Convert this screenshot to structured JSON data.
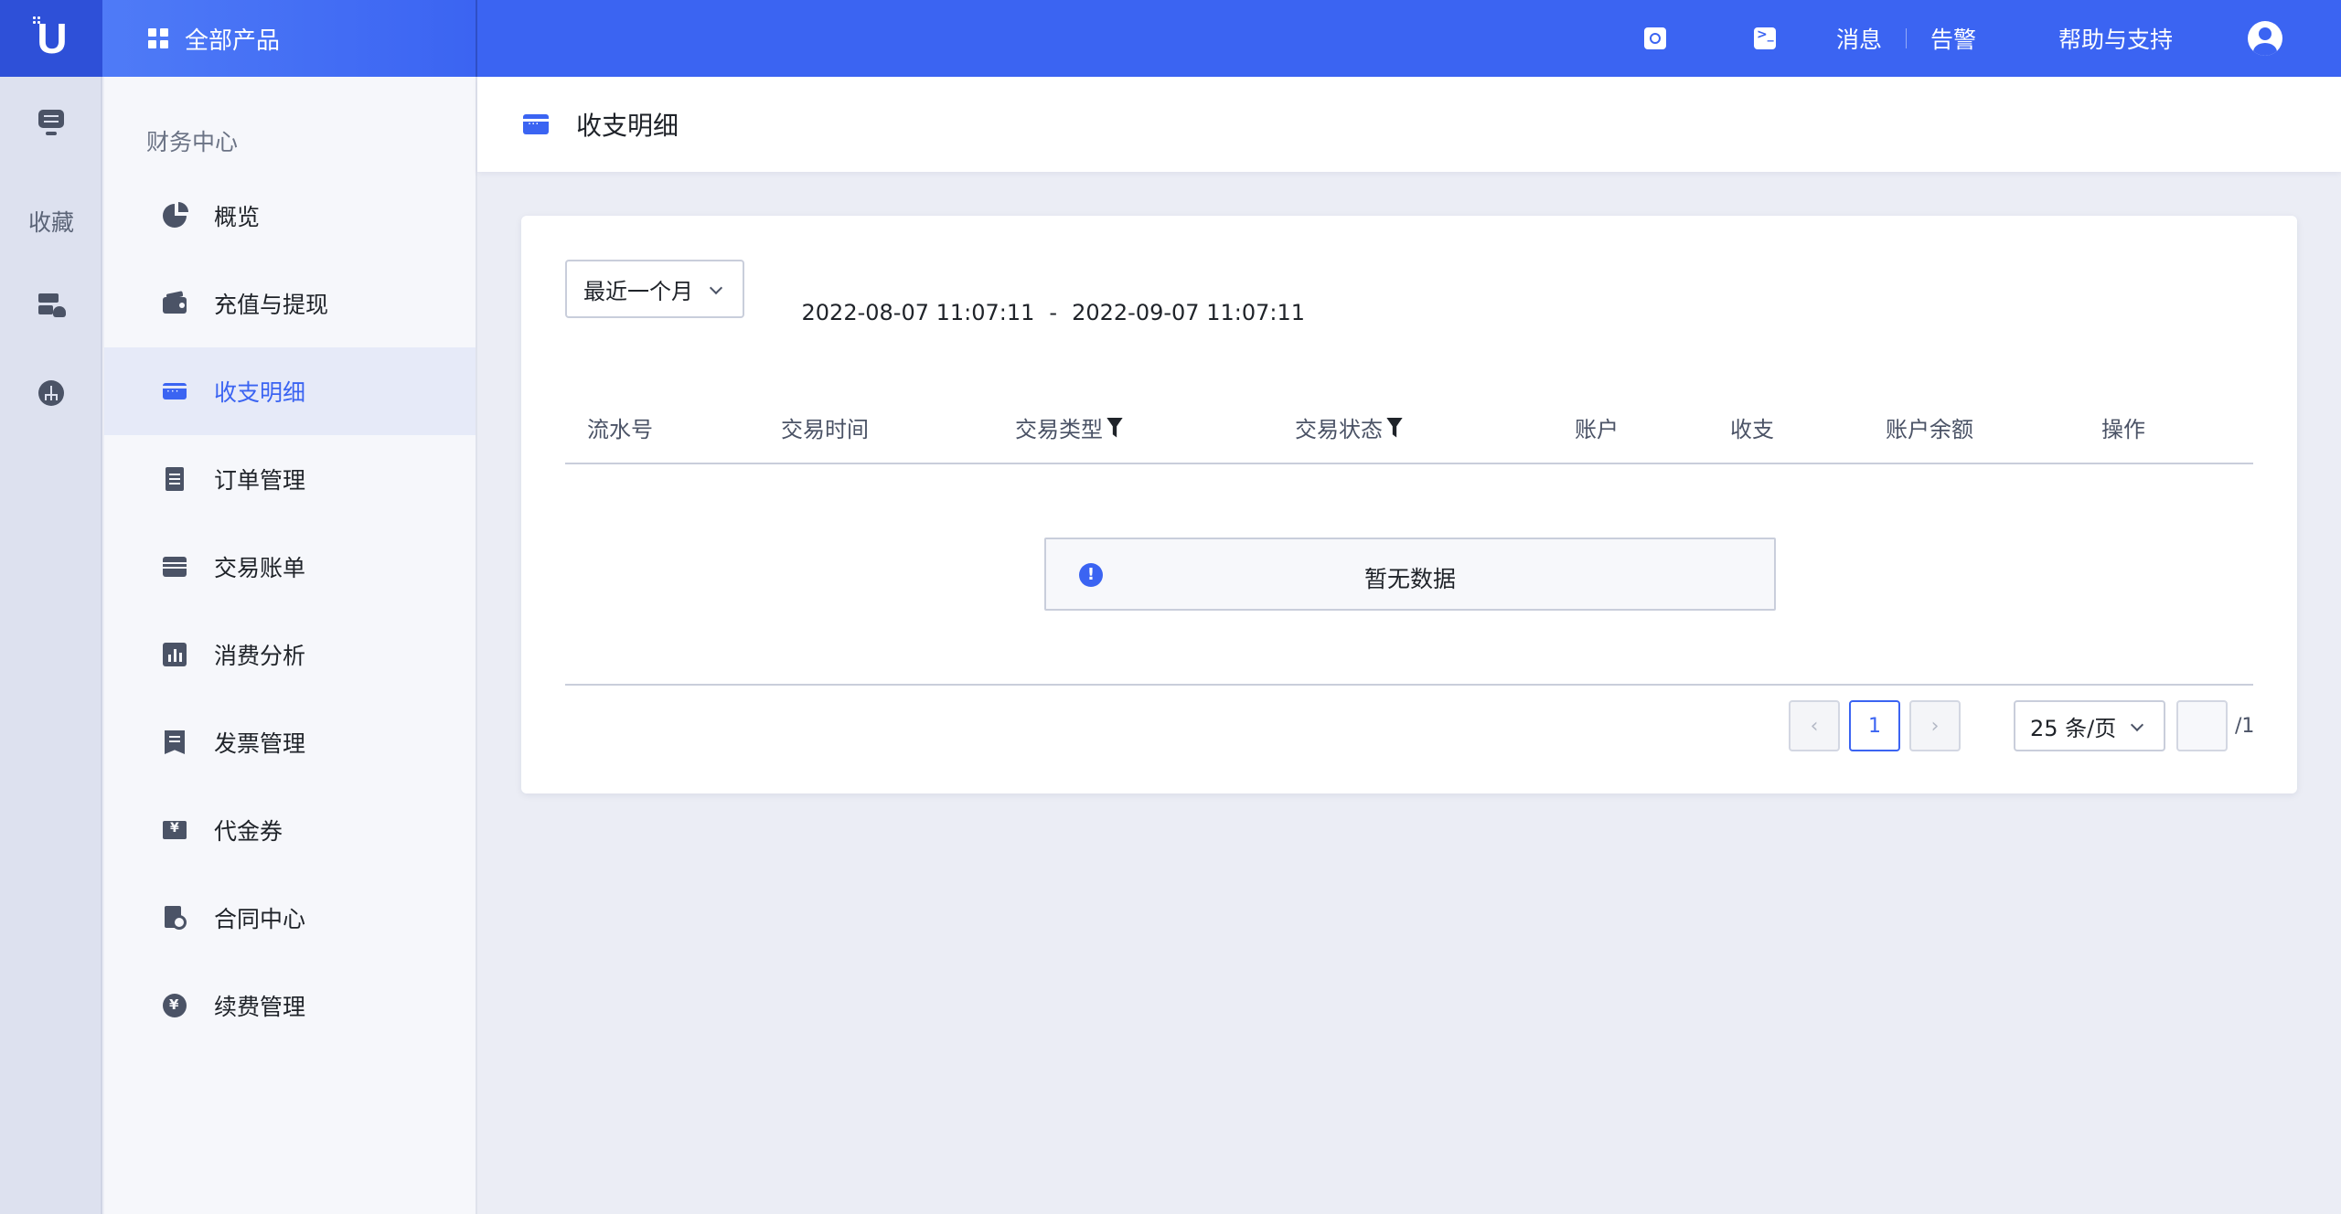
{
  "topbar": {
    "logo_letter": "U",
    "all_products": "全部产品",
    "messages": "消息",
    "alerts": "告警",
    "help": "帮助与支持",
    "icons": [
      "search-icon",
      "terminal-icon",
      "user-icon"
    ]
  },
  "rail": {
    "favorites": "收藏",
    "icons": [
      "monitor-icon",
      "server-icon",
      "network-icon"
    ]
  },
  "sidebar": {
    "section_title": "财务中心",
    "items": [
      {
        "label": "概览",
        "icon": "pie-chart-icon"
      },
      {
        "label": "充值与提现",
        "icon": "wallet-icon"
      },
      {
        "label": "收支明细",
        "icon": "card-icon",
        "active": true
      },
      {
        "label": "订单管理",
        "icon": "document-icon"
      },
      {
        "label": "交易账单",
        "icon": "bill-icon"
      },
      {
        "label": "消费分析",
        "icon": "bar-chart-icon"
      },
      {
        "label": "发票管理",
        "icon": "invoice-icon"
      },
      {
        "label": "代金券",
        "icon": "coupon-icon"
      },
      {
        "label": "合同中心",
        "icon": "contract-icon"
      },
      {
        "label": "续费管理",
        "icon": "renew-icon"
      }
    ]
  },
  "page": {
    "title": "收支明细"
  },
  "filter": {
    "range_selected": "最近一个月",
    "date_start": "2022-08-07 11:07:11",
    "date_separator": "-",
    "date_end": "2022-09-07 11:07:11"
  },
  "table": {
    "columns": [
      {
        "label": "流水号",
        "filterable": false
      },
      {
        "label": "交易时间",
        "filterable": false
      },
      {
        "label": "交易类型",
        "filterable": true
      },
      {
        "label": "交易状态",
        "filterable": true
      },
      {
        "label": "账户",
        "filterable": false
      },
      {
        "label": "收支",
        "filterable": false
      },
      {
        "label": "账户余额",
        "filterable": false
      },
      {
        "label": "操作",
        "filterable": false
      }
    ],
    "rows": [],
    "empty_text": "暂无数据"
  },
  "pagination": {
    "prev": "‹",
    "current_page": "1",
    "next": "›",
    "page_size": "25 条/页",
    "jump_value": "",
    "total_pages": "/1"
  },
  "colors": {
    "brand_blue": "#3b64f2",
    "text_dark": "#1f2329",
    "text_muted": "#4b5366",
    "border": "#c9cedb"
  }
}
